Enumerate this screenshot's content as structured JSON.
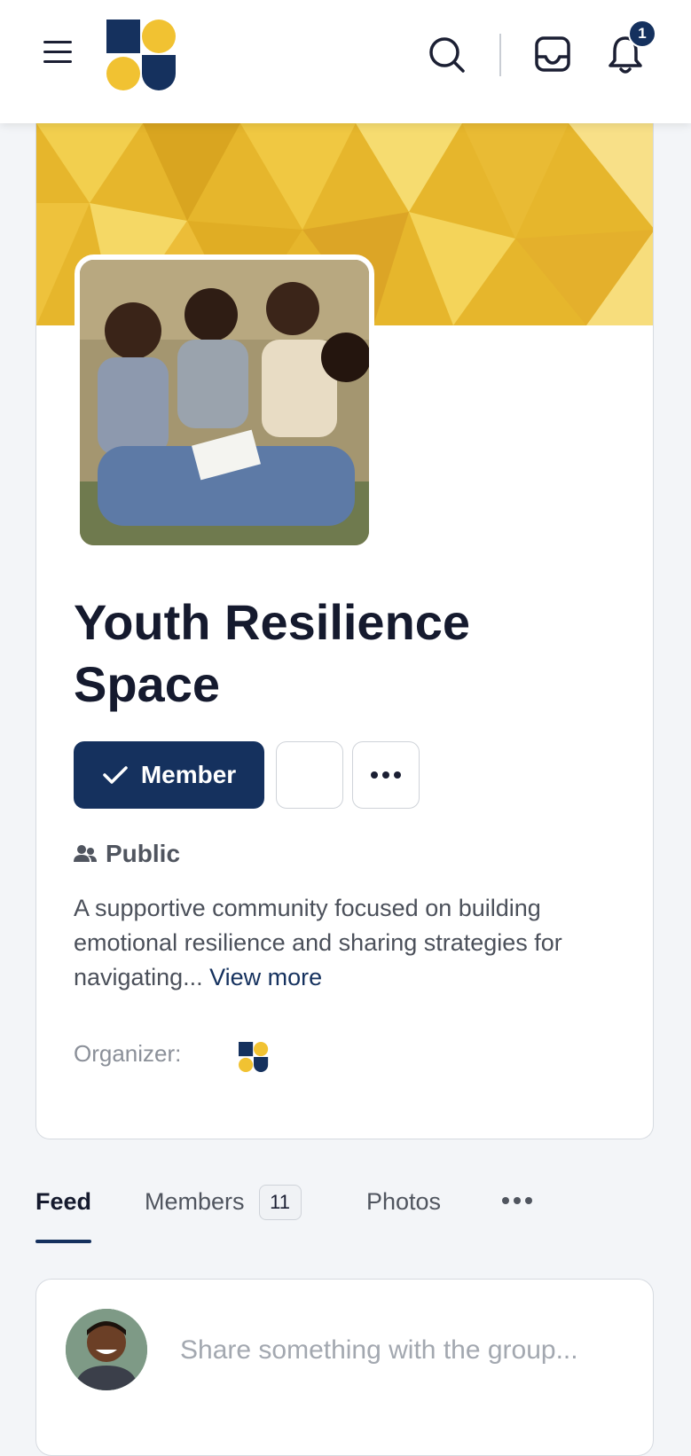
{
  "header": {
    "menu_icon": "hamburger-menu-icon",
    "logo_icon": "brand-logo",
    "search_icon": "search-icon",
    "inbox_icon": "inbox-tray-icon",
    "notifications_icon": "bell-icon",
    "notification_count": "1"
  },
  "group": {
    "cover_icon": "geometric-gold-cover",
    "photo_icon": "group-photo-students",
    "title": "Youth Resilience Space",
    "member_button_label": "Member",
    "member_button_icon": "checkmark-icon",
    "privacy_icon": "people-icon",
    "privacy_label": "Public",
    "description": "A supportive community focused on building emotional resilience and sharing strategies for navigating...",
    "view_more_label": "View more",
    "organizer_label": "Organizer:"
  },
  "tabs": [
    {
      "label": "Feed",
      "active": true
    },
    {
      "label": "Members",
      "count": "11"
    },
    {
      "label": "Photos"
    }
  ],
  "composer": {
    "placeholder": "Share something with the group..."
  },
  "colors": {
    "primary": "#15315e",
    "accent": "#f1c232",
    "background": "#f3f5f8"
  }
}
